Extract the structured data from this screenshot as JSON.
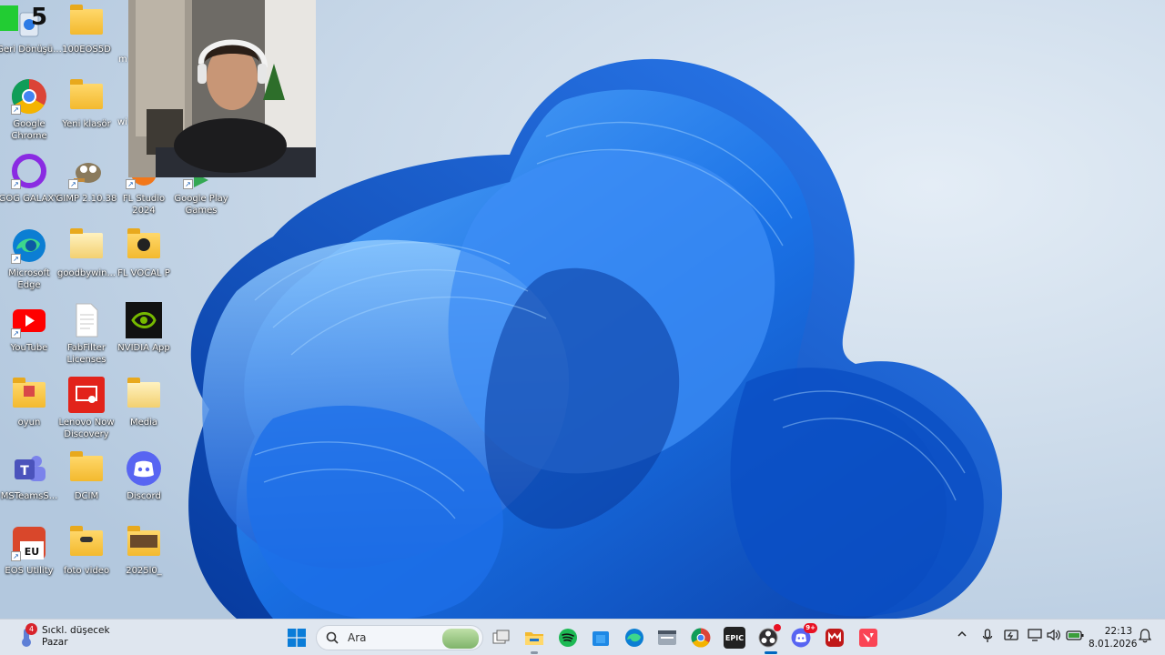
{
  "desktop": {
    "icons": [
      {
        "label": "Geri Dönüşü...",
        "icon": "recycle-bin-icon"
      },
      {
        "label": "100EOS5D",
        "icon": "folder-icon"
      },
      {
        "label": "Google Chrome",
        "icon": "chrome-icon"
      },
      {
        "label": "Yeni klasör",
        "icon": "folder-icon"
      },
      {
        "label": "GOG GALAXY",
        "icon": "gog-galaxy-icon"
      },
      {
        "label": "GIMP 2.10.38",
        "icon": "gimp-icon"
      },
      {
        "label": "FL Studio 2024",
        "icon": "fl-studio-icon"
      },
      {
        "label": "Google Play Games",
        "icon": "google-play-games-icon"
      },
      {
        "label": "Microsoft Edge",
        "icon": "edge-icon"
      },
      {
        "label": "goodbywin...",
        "icon": "folder-icon"
      },
      {
        "label": "FL VOCAL P",
        "icon": "folder-icon"
      },
      {
        "label": "YouTube",
        "icon": "youtube-icon"
      },
      {
        "label": "FabFilter Licenses",
        "icon": "document-icon"
      },
      {
        "label": "NVIDIA App",
        "icon": "nvidia-icon"
      },
      {
        "label": "oyun",
        "icon": "folder-icon"
      },
      {
        "label": "Lenovo Now Discovery",
        "icon": "lenovo-now-icon"
      },
      {
        "label": "Media",
        "icon": "folder-icon"
      },
      {
        "label": "MSTeamsS...",
        "icon": "teams-icon"
      },
      {
        "label": "DCIM",
        "icon": "folder-icon"
      },
      {
        "label": "Discord",
        "icon": "discord-icon"
      },
      {
        "label": "EOS Utility",
        "icon": "eos-utility-icon"
      },
      {
        "label": "foto video",
        "icon": "folder-icon"
      },
      {
        "label": "2025l0_",
        "icon": "folder-icon"
      }
    ],
    "partial_labels": [
      "m",
      "wi"
    ],
    "overlay_badge": "5"
  },
  "taskbar": {
    "weather": {
      "badge": "4",
      "title": "Sıckl. düşecek",
      "subtitle": "Pazar"
    },
    "search_placeholder": "Ara",
    "apps": [
      "windows-start-icon",
      "task-view-icon",
      "file-explorer-icon",
      "spotify-icon",
      "store-icon",
      "edge-icon",
      "terminal-icon",
      "chrome-icon",
      "epic-games-icon",
      "obs-icon",
      "discord-icon",
      "mcafee-icon",
      "valorant-icon"
    ],
    "epic_label": "EPIC",
    "discord_badge": "9+",
    "clock": {
      "time": "22:13",
      "date": "8.01.2026"
    }
  },
  "colors": {
    "accent": "#0067c0",
    "taskbar": "#dfe6ef"
  }
}
